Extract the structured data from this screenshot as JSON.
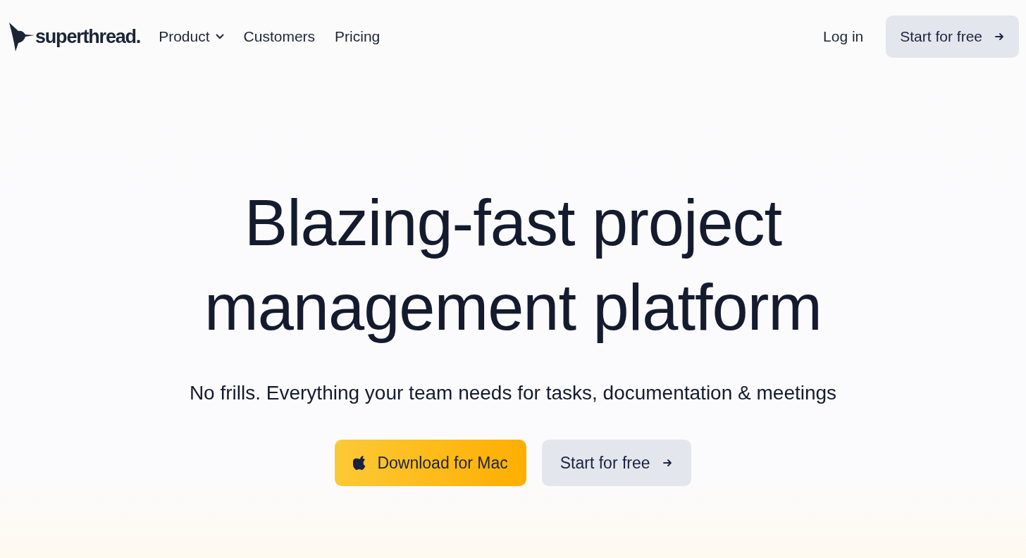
{
  "nav": {
    "logo": "superthread.",
    "links": [
      {
        "label": "Product",
        "kind": "dropdown"
      },
      {
        "label": "Customers",
        "kind": "link"
      },
      {
        "label": "Pricing",
        "kind": "link"
      }
    ],
    "login": "Log in",
    "cta": "Start for free"
  },
  "hero": {
    "headline": [
      "Blazing-fast project",
      "management platform"
    ],
    "subtitle": "No frills. Everything your team needs for tasks, documentation & meetings",
    "buttons": [
      {
        "label": "Download for Mac",
        "kind": "primary"
      },
      {
        "label": "Start for free",
        "kind": "secondary"
      }
    ]
  }
}
